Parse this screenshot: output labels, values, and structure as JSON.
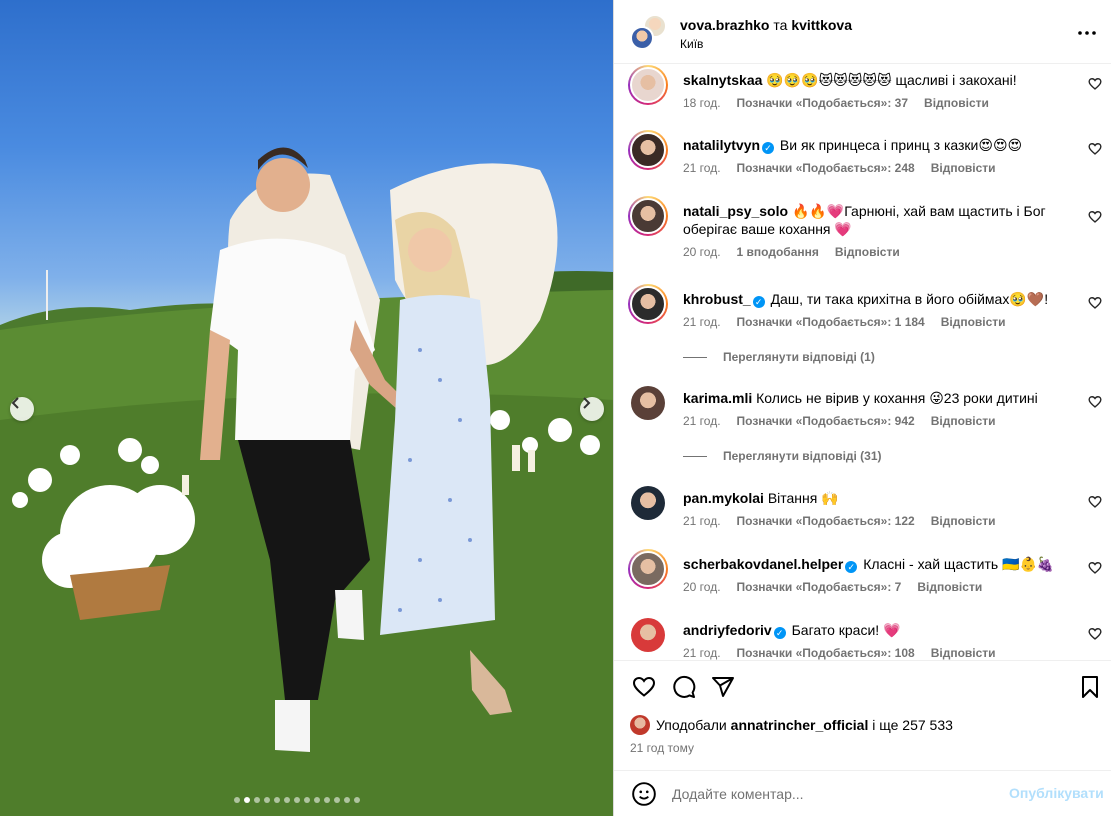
{
  "post": {
    "author1": "vova.brazhko",
    "conjunction": "та",
    "author2": "kvittkova",
    "location": "Київ"
  },
  "carousel": {
    "total_slides": 13,
    "active_index": 1
  },
  "comments": [
    {
      "user": "skalnytskaa",
      "verified": false,
      "text": "🥹🥹🥹😻😻😻😻😻 щасливі і закохані!",
      "time": "18 год.",
      "likes": "Позначки «Подобається»: 37",
      "reply": "Відповісти",
      "ring": true,
      "avatar_color": "#e8d6cf"
    },
    {
      "user": "natalilytvyn",
      "verified": true,
      "text": "Ви як принцеса і принц з казки😍😍😍",
      "time": "21 год.",
      "likes": "Позначки «Подобається»: 248",
      "reply": "Відповісти",
      "ring": true,
      "avatar_color": "#3a2a25"
    },
    {
      "user": "natali_psy_solo",
      "verified": false,
      "text": "🔥🔥💗Гарнюні, хай вам щастить і Бог оберігає ваше кохання 💗",
      "time": "20 год.",
      "likes": "1 вподобання",
      "reply": "Відповісти",
      "ring": true,
      "avatar_color": "#4a3a35"
    },
    {
      "user": "khrobust_",
      "verified": true,
      "text": "Даш, ти така крихітна в його обіймах🥹🤎!",
      "time": "21 год.",
      "likes": "Позначки «Подобається»: 1 184",
      "reply": "Відповісти",
      "ring": true,
      "avatar_color": "#2b2b2b",
      "view_replies": "Переглянути відповіді (1)"
    },
    {
      "user": "karima.mli",
      "verified": false,
      "text": "Колись не вірив у кохання 😜23 роки дитині",
      "time": "21 год.",
      "likes": "Позначки «Подобається»: 942",
      "reply": "Відповісти",
      "ring": false,
      "avatar_color": "#5a4038",
      "view_replies": "Переглянути відповіді (31)"
    },
    {
      "user": "pan.mykolai",
      "verified": false,
      "text": "Вітання 🙌",
      "time": "21 год.",
      "likes": "Позначки «Подобається»: 122",
      "reply": "Відповісти",
      "ring": false,
      "avatar_color": "#1e2a38"
    },
    {
      "user": "scherbakovdanel.helper",
      "verified": true,
      "text": "Класні - хай щастить 🇺🇦👶🍇",
      "time": "20 год.",
      "likes": "Позначки «Подобається»: 7",
      "reply": "Відповісти",
      "ring": true,
      "avatar_color": "#7a6a60"
    },
    {
      "user": "andriyfedoriv",
      "verified": true,
      "text": "Багато краси! 💗",
      "time": "21 год.",
      "likes": "Позначки «Подобається»: 108",
      "reply": "Відповісти",
      "ring": false,
      "avatar_color": "#d83a3a"
    }
  ],
  "likes": {
    "prefix": "Уподобали",
    "user": "annatrincher_official",
    "suffix": "і ще 257 533"
  },
  "time_ago": "21 год тому",
  "composer": {
    "placeholder": "Додайте коментар...",
    "publish_label": "Опублікувати"
  },
  "colors": {
    "accent": "#0095f6",
    "publish_disabled": "#b2dffc",
    "meta": "#737373"
  }
}
